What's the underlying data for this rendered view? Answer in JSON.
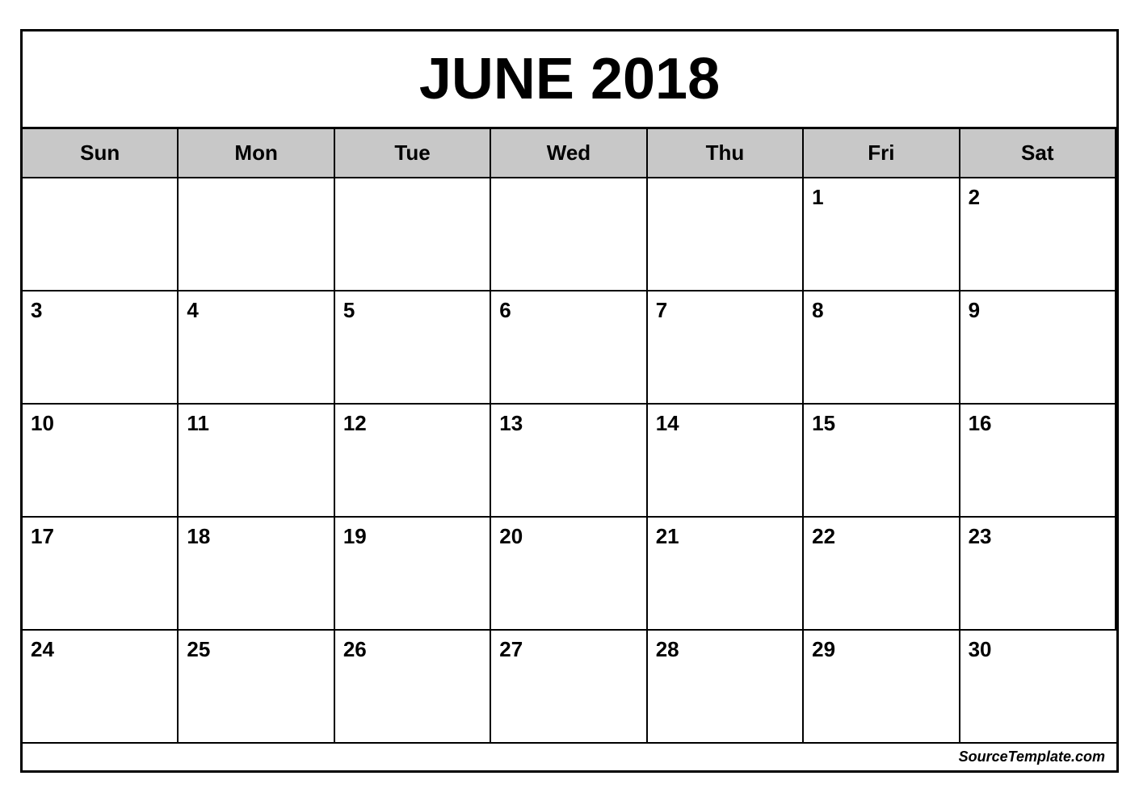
{
  "calendar": {
    "title": "JUNE 2018",
    "footer": "SourceTemplate.com",
    "days_of_week": [
      "Sun",
      "Mon",
      "Tue",
      "Wed",
      "Thu",
      "Fri",
      "Sat"
    ],
    "weeks": [
      [
        {
          "day": "",
          "empty": true
        },
        {
          "day": "",
          "empty": true
        },
        {
          "day": "",
          "empty": true
        },
        {
          "day": "",
          "empty": true
        },
        {
          "day": "",
          "empty": true
        },
        {
          "day": "1",
          "empty": false
        },
        {
          "day": "2",
          "empty": false
        }
      ],
      [
        {
          "day": "3",
          "empty": false
        },
        {
          "day": "4",
          "empty": false
        },
        {
          "day": "5",
          "empty": false
        },
        {
          "day": "6",
          "empty": false
        },
        {
          "day": "7",
          "empty": false
        },
        {
          "day": "8",
          "empty": false
        },
        {
          "day": "9",
          "empty": false
        }
      ],
      [
        {
          "day": "10",
          "empty": false
        },
        {
          "day": "11",
          "empty": false
        },
        {
          "day": "12",
          "empty": false
        },
        {
          "day": "13",
          "empty": false
        },
        {
          "day": "14",
          "empty": false
        },
        {
          "day": "15",
          "empty": false
        },
        {
          "day": "16",
          "empty": false
        }
      ],
      [
        {
          "day": "17",
          "empty": false
        },
        {
          "day": "18",
          "empty": false
        },
        {
          "day": "19",
          "empty": false
        },
        {
          "day": "20",
          "empty": false
        },
        {
          "day": "21",
          "empty": false
        },
        {
          "day": "22",
          "empty": false
        },
        {
          "day": "23",
          "empty": false
        }
      ],
      [
        {
          "day": "24",
          "empty": false
        },
        {
          "day": "25",
          "empty": false
        },
        {
          "day": "26",
          "empty": false
        },
        {
          "day": "27",
          "empty": false
        },
        {
          "day": "28",
          "empty": false
        },
        {
          "day": "29",
          "empty": false
        },
        {
          "day": "30",
          "empty": false
        }
      ]
    ]
  }
}
